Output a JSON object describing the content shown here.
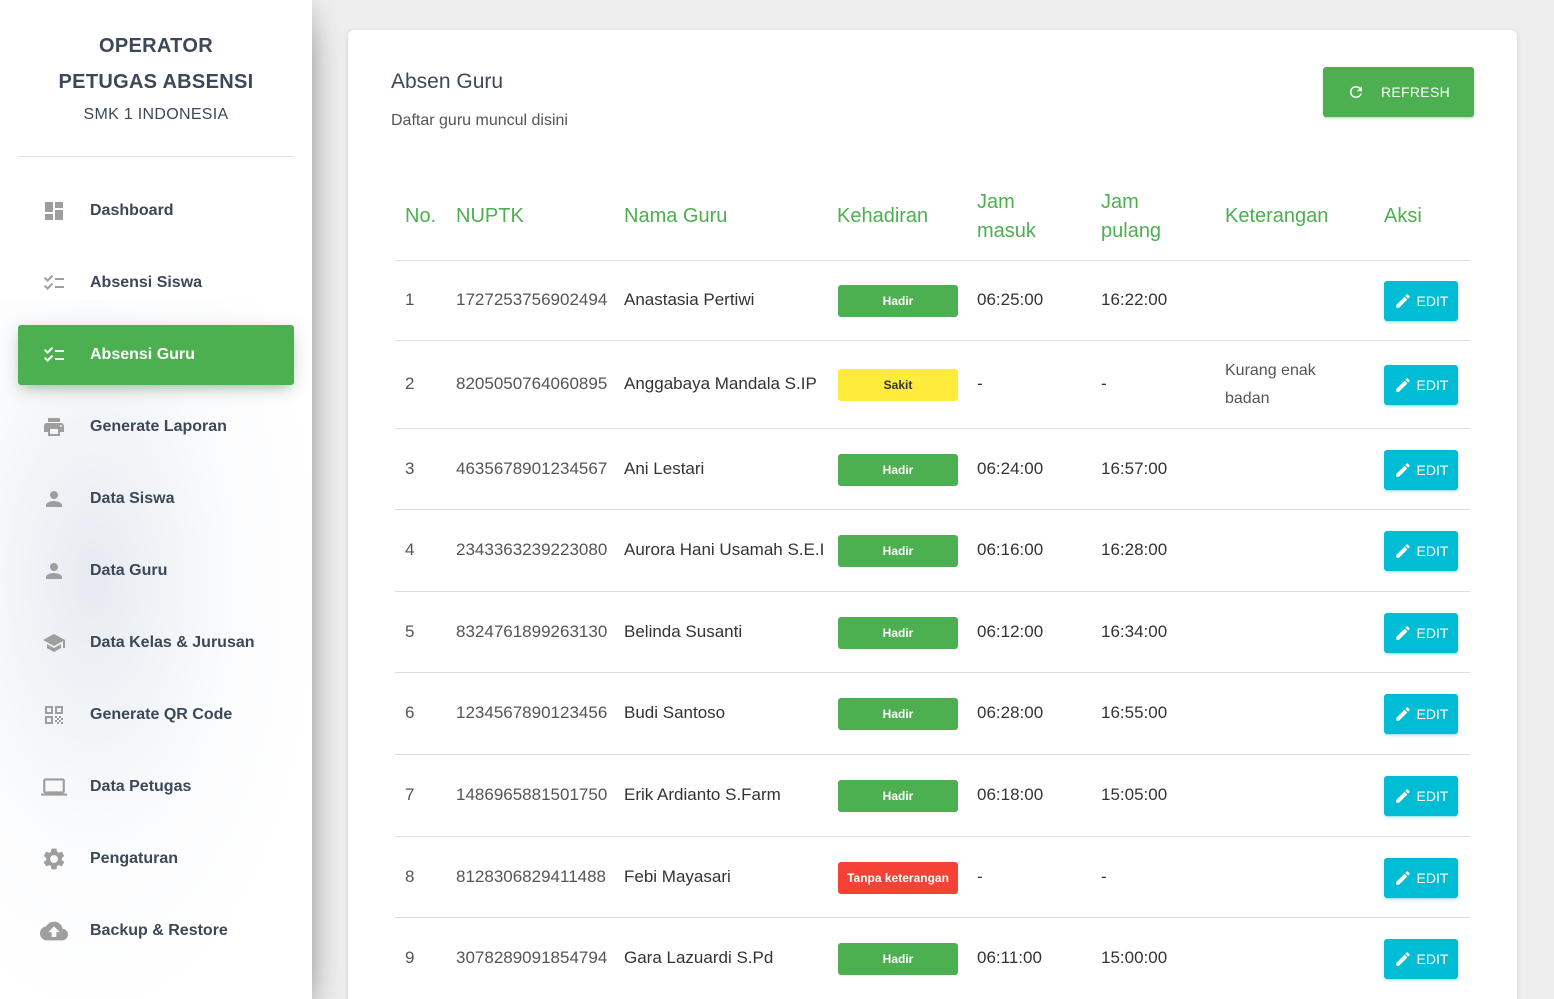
{
  "sidebar": {
    "brand_line1": "OPERATOR",
    "brand_line2": "PETUGAS ABSENSI",
    "brand_sub": "SMK 1 INDONESIA",
    "items": [
      {
        "label": "Dashboard",
        "icon": "dashboard-icon",
        "active": false
      },
      {
        "label": "Absensi Siswa",
        "icon": "checklist-icon",
        "active": false
      },
      {
        "label": "Absensi Guru",
        "icon": "checklist-icon",
        "active": true
      },
      {
        "label": "Generate Laporan",
        "icon": "printer-icon",
        "active": false
      },
      {
        "label": "Data Siswa",
        "icon": "person-icon",
        "active": false
      },
      {
        "label": "Data Guru",
        "icon": "person-icon",
        "active": false
      },
      {
        "label": "Data Kelas & Jurusan",
        "icon": "school-icon",
        "active": false
      },
      {
        "label": "Generate QR Code",
        "icon": "qr-code-icon",
        "active": false
      },
      {
        "label": "Data Petugas",
        "icon": "laptop-icon",
        "active": false
      },
      {
        "label": "Pengaturan",
        "icon": "gear-icon",
        "active": false
      },
      {
        "label": "Backup & Restore",
        "icon": "cloud-upload-icon",
        "active": false
      }
    ]
  },
  "main": {
    "title": "Absen Guru",
    "subtitle": "Daftar guru muncul disini",
    "refresh_label": "REFRESH",
    "table": {
      "headers": {
        "no": "No.",
        "nuptk": "NUPTK",
        "nama": "Nama Guru",
        "kehadiran": "Kehadiran",
        "jam_masuk_1": "Jam",
        "jam_masuk_2": "masuk",
        "jam_pulang_1": "Jam",
        "jam_pulang_2": "pulang",
        "keterangan": "Keterangan",
        "aksi": "Aksi"
      },
      "edit_label": "EDIT",
      "rows": [
        {
          "no": "1",
          "nuptk": "1727253756902494",
          "nama": "Anastasia Pertiwi",
          "kehadiran": "Hadir",
          "status": "hadir",
          "jam_masuk": "06:25:00",
          "jam_pulang": "16:22:00",
          "keterangan_1": "",
          "keterangan_2": ""
        },
        {
          "no": "2",
          "nuptk": "8205050764060895",
          "nama": "Anggabaya Mandala S.IP",
          "kehadiran": "Sakit",
          "status": "sakit",
          "jam_masuk": "-",
          "jam_pulang": "-",
          "keterangan_1": "Kurang enak",
          "keterangan_2": "badan"
        },
        {
          "no": "3",
          "nuptk": "4635678901234567",
          "nama": "Ani Lestari",
          "kehadiran": "Hadir",
          "status": "hadir",
          "jam_masuk": "06:24:00",
          "jam_pulang": "16:57:00",
          "keterangan_1": "",
          "keterangan_2": ""
        },
        {
          "no": "4",
          "nuptk": "2343363239223080",
          "nama": "Aurora Hani Usamah S.E.I",
          "kehadiran": "Hadir",
          "status": "hadir",
          "jam_masuk": "06:16:00",
          "jam_pulang": "16:28:00",
          "keterangan_1": "",
          "keterangan_2": ""
        },
        {
          "no": "5",
          "nuptk": "8324761899263130",
          "nama": "Belinda Susanti",
          "kehadiran": "Hadir",
          "status": "hadir",
          "jam_masuk": "06:12:00",
          "jam_pulang": "16:34:00",
          "keterangan_1": "",
          "keterangan_2": ""
        },
        {
          "no": "6",
          "nuptk": "1234567890123456",
          "nama": "Budi Santoso",
          "kehadiran": "Hadir",
          "status": "hadir",
          "jam_masuk": "06:28:00",
          "jam_pulang": "16:55:00",
          "keterangan_1": "",
          "keterangan_2": ""
        },
        {
          "no": "7",
          "nuptk": "1486965881501750",
          "nama": "Erik Ardianto S.Farm",
          "kehadiran": "Hadir",
          "status": "hadir",
          "jam_masuk": "06:18:00",
          "jam_pulang": "15:05:00",
          "keterangan_1": "",
          "keterangan_2": ""
        },
        {
          "no": "8",
          "nuptk": "8128306829411488",
          "nama": "Febi Mayasari",
          "kehadiran": "Tanpa keterangan",
          "status": "tanpa",
          "jam_masuk": "-",
          "jam_pulang": "-",
          "keterangan_1": "",
          "keterangan_2": ""
        },
        {
          "no": "9",
          "nuptk": "3078289091854794",
          "nama": "Gara Lazuardi S.Pd",
          "kehadiran": "Hadir",
          "status": "hadir",
          "jam_masuk": "06:11:00",
          "jam_pulang": "15:00:00",
          "keterangan_1": "",
          "keterangan_2": ""
        }
      ]
    }
  },
  "colors": {
    "primary": "#4caf50",
    "info": "#00bcd4",
    "warning": "#ffeb3b",
    "danger": "#f44336"
  }
}
